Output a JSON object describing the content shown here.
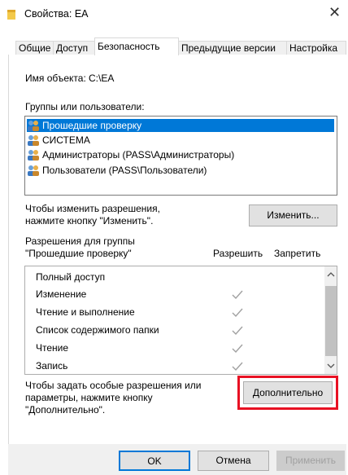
{
  "window": {
    "title": "Свойства: EA",
    "close_glyph": "✕"
  },
  "tabs": [
    {
      "label": "Общие"
    },
    {
      "label": "Доступ"
    },
    {
      "label": "Безопасность"
    },
    {
      "label": "Предыдущие версии"
    },
    {
      "label": "Настройка"
    }
  ],
  "security": {
    "object_name_label": "Имя объекта:",
    "object_name_value": "C:\\EA",
    "groups_label": "Группы или пользователи:",
    "groups": [
      {
        "label": "Прошедшие проверку",
        "icon": "users-icon"
      },
      {
        "label": "СИСТЕМА",
        "icon": "users-icon"
      },
      {
        "label": "Администраторы (PASS\\Администраторы)",
        "icon": "users-icon"
      },
      {
        "label": "Пользователи (PASS\\Пользователи)",
        "icon": "users-icon"
      }
    ],
    "change_hint_line1": "Чтобы изменить разрешения,",
    "change_hint_line2": "нажмите кнопку \"Изменить\".",
    "change_button": "Изменить...",
    "permissions_for_line1": "Разрешения для группы",
    "permissions_for_line2": "\"Прошедшие проверку\"",
    "allow_header": "Разрешить",
    "deny_header": "Запретить",
    "permissions": [
      {
        "label": "Полный доступ",
        "allow": false
      },
      {
        "label": "Изменение",
        "allow": true
      },
      {
        "label": "Чтение и выполнение",
        "allow": true
      },
      {
        "label": "Список содержимого папки",
        "allow": true
      },
      {
        "label": "Чтение",
        "allow": true
      },
      {
        "label": "Запись",
        "allow": true
      }
    ],
    "advanced_hint_line1": "Чтобы задать особые разрешения или",
    "advanced_hint_line2": "параметры, нажмите кнопку",
    "advanced_hint_line3": "\"Дополнительно\".",
    "advanced_button": "Дополнительно"
  },
  "footer": {
    "ok": "OK",
    "cancel": "Отмена",
    "apply": "Применить"
  },
  "colors": {
    "selection": "#0078d7",
    "highlight_outline": "#e81123",
    "disabled_text": "#a0a0a0"
  }
}
